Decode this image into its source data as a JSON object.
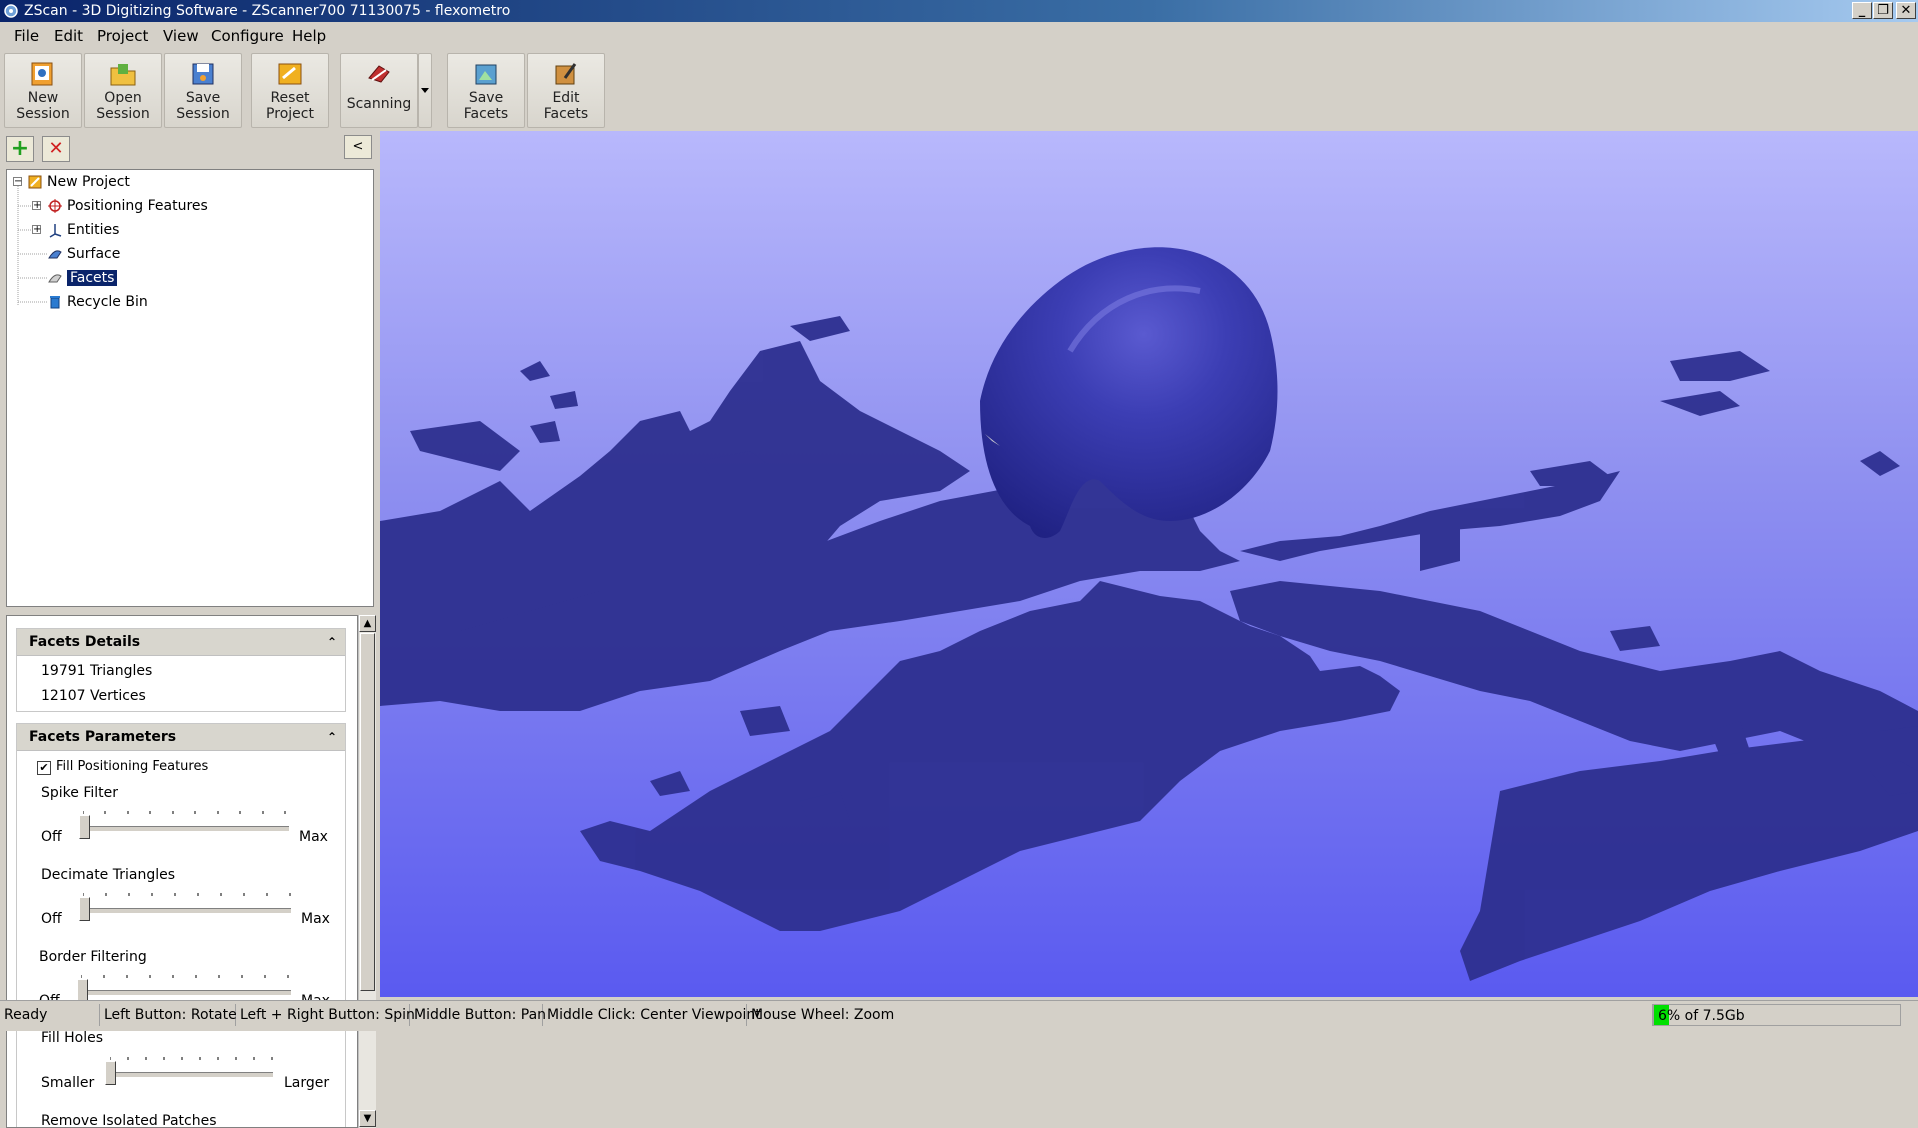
{
  "window": {
    "title": "ZScan - 3D Digitizing Software - ZScanner700 71130075 - flexometro",
    "controls": {
      "minimize": "_",
      "restore": "❐",
      "close": "✕"
    }
  },
  "menu": [
    "File",
    "Edit",
    "Project",
    "View",
    "Configure",
    "Help"
  ],
  "toolbar": {
    "new_session": "New\nSession",
    "open_session": "Open\nSession",
    "save_session": "Save\nSession",
    "reset_project": "Reset\nProject",
    "scanning": "Scanning",
    "save_facets": "Save\nFacets",
    "edit_facets": "Edit\nFacets"
  },
  "panel": {
    "collapse": "<",
    "add": "+",
    "remove": "✕"
  },
  "tree": {
    "root": "New Project",
    "items": [
      "Positioning Features",
      "Entities",
      "Surface",
      "Facets",
      "Recycle Bin"
    ],
    "selected": "Facets"
  },
  "facets_details": {
    "title": "Facets Details",
    "triangles": "19791 Triangles",
    "vertices": "12107 Vertices"
  },
  "facets_parameters": {
    "title": "Facets Parameters",
    "fill_positioning": "Fill Positioning Features",
    "fill_positioning_checked": true,
    "sliders": [
      {
        "label": "Spike Filter",
        "min": "Off",
        "max": "Max",
        "value": 0
      },
      {
        "label": "Decimate Triangles",
        "min": "Off",
        "max": "Max",
        "value": 0
      },
      {
        "label": "Border Filtering",
        "min": "Off",
        "max": "Max",
        "value": 0
      },
      {
        "label": "Fill Holes",
        "min": "Smaller",
        "max": "Larger",
        "value": 0.1
      }
    ],
    "remove_isolated": "Remove Isolated Patches"
  },
  "status": {
    "ready": "Ready",
    "left": "Left Button: Rotate",
    "left_right": "Left + Right Button: Spin",
    "middle": "Middle Button: Pan",
    "middle_click": "Middle Click: Center Viewpoint",
    "wheel": "Mouse Wheel: Zoom",
    "memory": "6% of 7.5Gb",
    "memory_fraction": 0.06
  },
  "colors": {
    "accent": "#0a246a",
    "mesh": "#2c2e8c",
    "memory_fill": "#00e000"
  }
}
